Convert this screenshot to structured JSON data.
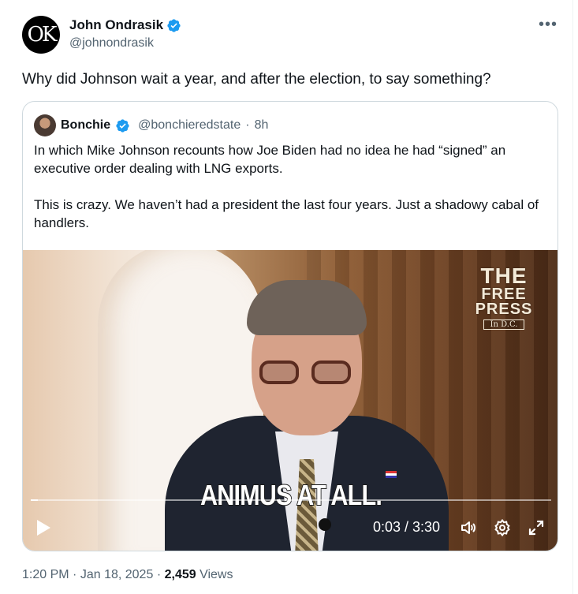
{
  "author": {
    "avatar_text": "OK",
    "display_name": "John Ondrasik",
    "handle": "@johnondrasik"
  },
  "tweet": {
    "text": "Why did Johnson wait a year, and after the election, to say something?",
    "time": "1:20 PM",
    "date": "Jan 18, 2025",
    "views_count": "2,459",
    "views_label": "Views"
  },
  "quote": {
    "display_name": "Bonchie",
    "handle": "@bonchieredstate",
    "age": "8h",
    "paragraph1": "In which Mike Johnson recounts how Joe Biden had no idea he had “signed” an executive order dealing with LNG exports.",
    "paragraph2": "This is crazy. We haven’t had a president the last four years. Just a shadowy cabal of handlers."
  },
  "video": {
    "caption": "ANIMUS AT ALL.",
    "watermark": [
      "THE",
      "FREE",
      "PRESS",
      "In D.C."
    ],
    "time_display": "0:03 / 3:30",
    "progress": 0.014
  },
  "icons": {
    "more": "more-options-icon",
    "verified": "verified-badge-icon",
    "play": "play-icon",
    "volume": "volume-icon",
    "settings": "settings-icon",
    "fullscreen": "fullscreen-icon"
  },
  "colors": {
    "verified_blue": "#1d9bf0",
    "text_secondary": "#536471",
    "border": "#cfd9de"
  }
}
